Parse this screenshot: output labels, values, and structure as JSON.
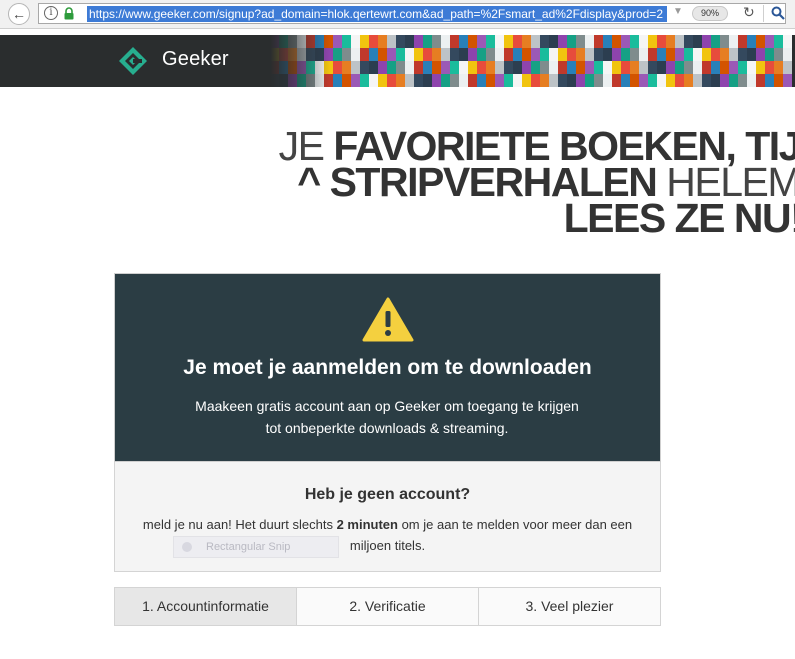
{
  "browser": {
    "url": "https://www.geeker.com/signup?ad_domain=hlok.qertewrt.com&ad_path=%2Fsmart_ad%2Fdisplay&prod=2",
    "zoom": "90%"
  },
  "site": {
    "brand": "Geeker",
    "colors": {
      "header_bg": "#2a2d2e",
      "logo_green": "#27ae8f",
      "card_dark": "#2b3d44",
      "warning_yellow": "#f4d03f"
    }
  },
  "headline": {
    "line1_light": "JE ",
    "line1_bold": "FAVORIETE BOEKEN, TIJ",
    "line2_bold": "^ STRIPVERHALEN",
    "line2_light": " HELEM",
    "line3_bold": "LEES ZE NU",
    "line3_light": "!"
  },
  "notice": {
    "title": "Je moet je aanmelden om te downloaden",
    "subtitle": "Maakeen gratis account aan op Geeker om toegang te krijgen tot onbeperkte downloads & streaming.",
    "no_account_title": "Heb je geen account?",
    "no_account_text_before": "meld je nu aan! Het duurt slechts ",
    "no_account_text_bold": "2 minuten",
    "no_account_text_after": " om je aan te melden voor meer dan een miljoen titels.",
    "overlay_label": "Rectangular Snip"
  },
  "steps": [
    {
      "label": "1. Accountinformatie",
      "active": true
    },
    {
      "label": "2. Verificatie",
      "active": false
    },
    {
      "label": "3. Veel plezier",
      "active": false
    }
  ]
}
